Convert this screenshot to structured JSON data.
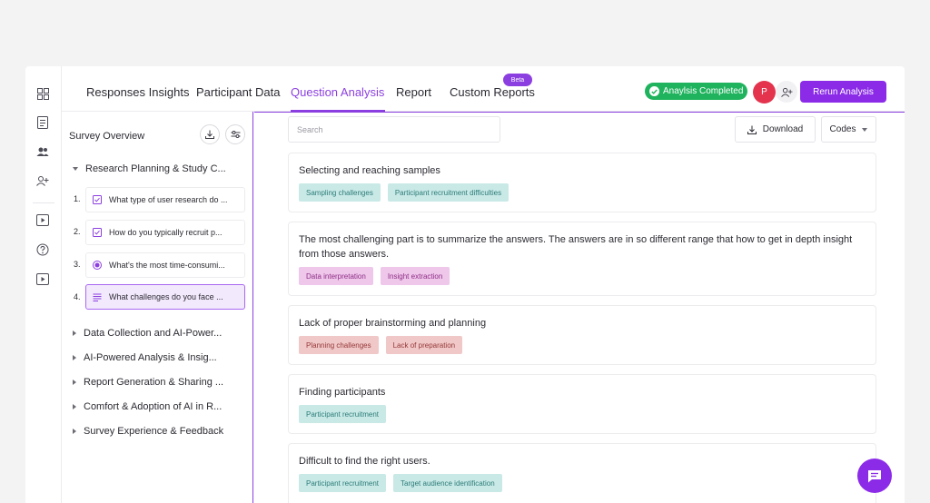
{
  "tabs": [
    {
      "label": "Responses Insights"
    },
    {
      "label": "Participant Data"
    },
    {
      "label": "Question Analysis"
    },
    {
      "label": "Report"
    },
    {
      "label": "Custom Reports"
    }
  ],
  "beta_label": "Beta",
  "status_label": "Anaylsis Completed",
  "avatar_initial": "P",
  "rerun_label": "Rerun Analysis",
  "sidebar": {
    "title": "Survey Overview",
    "expanded_section": "Research Planning & Study C...",
    "questions": [
      {
        "num": "1.",
        "text": "What type of user research do ...",
        "icon": "checkbox-icon"
      },
      {
        "num": "2.",
        "text": "How do you typically recruit p...",
        "icon": "checkbox-icon"
      },
      {
        "num": "3.",
        "text": "What's the most time-consumi...",
        "icon": "radio-icon"
      },
      {
        "num": "4.",
        "text": "What challenges do you face ...",
        "icon": "text-lines-icon"
      }
    ],
    "sections": [
      "Data Collection and AI-Power...",
      "AI-Powered Analysis & Insig...",
      "Report Generation & Sharing ...",
      "Comfort & Adoption of AI in R...",
      "Survey Experience & Feedback"
    ]
  },
  "main": {
    "search_placeholder": "Search",
    "download_label": "Download",
    "codes_label": "Codes",
    "responses": [
      {
        "text": "Selecting and reaching samples",
        "tags": [
          "Sampling challenges",
          "Participant recruitment difficulties"
        ],
        "tag_style": "teal"
      },
      {
        "text": "The most challenging part is to summarize the answers. The answers are in so different range that how to get in depth insight from those answers.",
        "tags": [
          "Data interpretation",
          "Insight extraction"
        ],
        "tag_style": "pink"
      },
      {
        "text": "Lack of proper brainstorming and planning",
        "tags": [
          "Planning challenges",
          "Lack of preparation"
        ],
        "tag_style": "rose"
      },
      {
        "text": "Finding participants",
        "tags": [
          "Participant recruitment"
        ],
        "tag_style": "teal"
      },
      {
        "text": "Difficult to find the right users.",
        "tags": [
          "Participant recruitment",
          "Target audience identification"
        ],
        "tag_style": "teal"
      }
    ]
  },
  "colors": {
    "accent": "#8b2be8",
    "success": "#1fb35d",
    "avatar": "#e3334d"
  }
}
